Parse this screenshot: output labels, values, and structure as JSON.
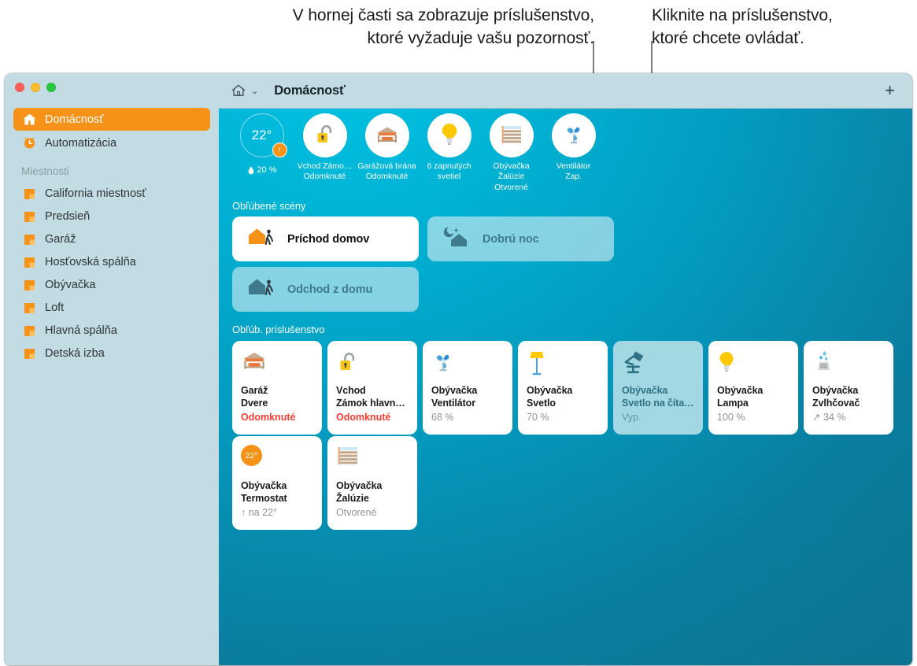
{
  "annotations": {
    "left": "V hornej časti sa zobrazuje príslušenstvo,\nktoré vyžaduje vašu pozornosť.",
    "right": "Kliknite na príslušenstvo,\nktoré chcete ovládať."
  },
  "window": {
    "titlebar": {
      "home_icon": "home-icon",
      "chevron": "⌄",
      "title": "Domácnosť",
      "add_label": "+"
    }
  },
  "sidebar": {
    "primary": [
      {
        "label": "Domácnosť",
        "icon": "home-icon",
        "active": true
      },
      {
        "label": "Automatizácia",
        "icon": "clock-icon",
        "active": false
      }
    ],
    "rooms_header": "Miestnosti",
    "rooms": [
      {
        "label": "California miestnosť",
        "icon": "room-icon"
      },
      {
        "label": "Predsieň",
        "icon": "room-icon"
      },
      {
        "label": "Garáž",
        "icon": "room-icon"
      },
      {
        "label": "Hosťovská spálňa",
        "icon": "room-icon"
      },
      {
        "label": "Obývačka",
        "icon": "room-icon"
      },
      {
        "label": "Loft",
        "icon": "room-icon"
      },
      {
        "label": "Hlavná spálňa",
        "icon": "room-icon"
      },
      {
        "label": "Detská izba",
        "icon": "room-icon"
      }
    ]
  },
  "status_strip": [
    {
      "type": "thermostat",
      "value": "22°",
      "badge": "↑",
      "humidity": "20 %",
      "icon": "thermostat-ring"
    },
    {
      "type": "accessory",
      "icon": "lock-open-icon",
      "line1": "Vchod Zámo…",
      "line2": "Odomknuté"
    },
    {
      "type": "accessory",
      "icon": "garage-door-icon",
      "line1": "Garážová brána",
      "line2": "Odomknuté"
    },
    {
      "type": "accessory",
      "icon": "lightbulb-icon",
      "line1": "6 zapnutých",
      "line2": "svetiel"
    },
    {
      "type": "accessory",
      "icon": "blinds-icon",
      "line1": "Obývačka Žalúzie",
      "line2": "Otvorené"
    },
    {
      "type": "accessory",
      "icon": "fan-icon",
      "line1": "Ventilátor",
      "line2": "Zap."
    }
  ],
  "scenes": {
    "title": "Obľúbené scény",
    "items": [
      {
        "label": "Príchod domov",
        "icon": "house-arrive-icon",
        "state": "on"
      },
      {
        "label": "Dobrú noc",
        "icon": "moon-house-icon",
        "state": "off"
      },
      {
        "label": "Odchod z domu",
        "icon": "house-leave-icon",
        "state": "off"
      }
    ]
  },
  "accessories": {
    "title": "Obľúb. príslušenstvo",
    "items": [
      {
        "icon": "garage-door-icon",
        "room": "Garáž",
        "name": "Dvere",
        "state": "Odomknuté",
        "alert": true,
        "selected": false
      },
      {
        "icon": "lock-open-icon",
        "room": "Vchod",
        "name": "Zámok hlavn…",
        "state": "Odomknuté",
        "alert": true,
        "selected": false
      },
      {
        "icon": "fan-icon",
        "room": "Obývačka",
        "name": "Ventilátor",
        "state": "68 %",
        "alert": false,
        "selected": false
      },
      {
        "icon": "floor-lamp-icon",
        "room": "Obývačka",
        "name": "Svetlo",
        "state": "70 %",
        "alert": false,
        "selected": false
      },
      {
        "icon": "desk-lamp-icon",
        "room": "Obývačka",
        "name": "Svetlo na číta…",
        "state": "Vyp.",
        "alert": false,
        "selected": true
      },
      {
        "icon": "lightbulb-icon",
        "room": "Obývačka",
        "name": "Lampa",
        "state": "100 %",
        "alert": false,
        "selected": false
      },
      {
        "icon": "humidifier-icon",
        "room": "Obývačka",
        "name": "Zvlhčovač",
        "state": "↗ 34 %",
        "alert": false,
        "selected": false
      },
      {
        "icon": "thermostat-icon",
        "room": "Obývačka",
        "name": "Termostat",
        "state": "↑ na 22°",
        "alert": false,
        "selected": false,
        "badge": "22°"
      },
      {
        "icon": "blinds-icon",
        "room": "Obývačka",
        "name": "Žalúzie",
        "state": "Otvorené",
        "alert": false,
        "selected": false
      }
    ]
  },
  "colors": {
    "accent_orange": "#f79219",
    "alert_red": "#ff3b30",
    "sidebar_bg": "#c3dbe2",
    "selected_tile": "#a3d8e3",
    "bg_cyan": "#00b3d5",
    "bg_teal": "#0c7593"
  }
}
